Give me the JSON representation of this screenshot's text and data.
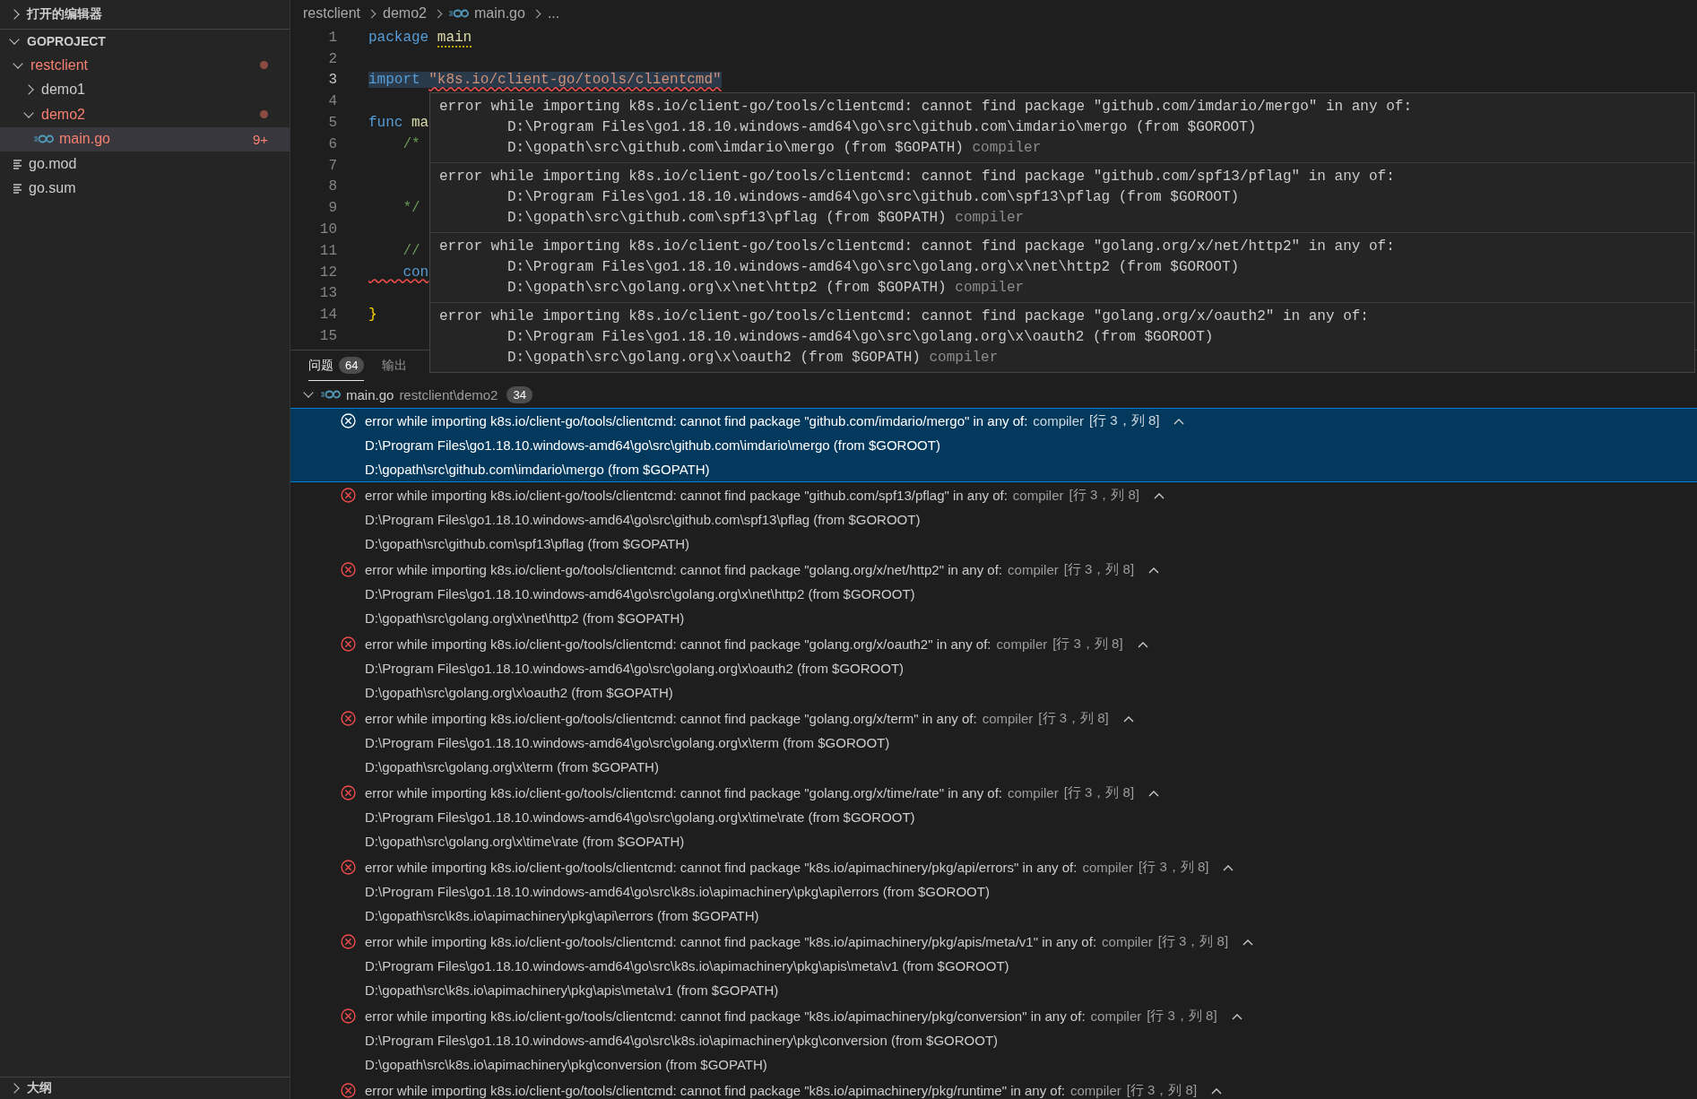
{
  "sidebar": {
    "open_editors": {
      "title": "打开的编辑器",
      "expanded": false
    },
    "explorer": {
      "title": "GOPROJECT",
      "expanded": true,
      "tree": [
        {
          "name": "restclient",
          "kind": "folder",
          "expanded": true,
          "error": true,
          "selected": false,
          "children": [
            {
              "name": "demo1",
              "kind": "folder",
              "expanded": false,
              "error": false,
              "selected": false
            },
            {
              "name": "demo2",
              "kind": "folder",
              "expanded": true,
              "error": true,
              "selected": false,
              "children": [
                {
                  "name": "main.go",
                  "kind": "go",
                  "error": true,
                  "badge": "9+",
                  "selected": true
                }
              ]
            }
          ]
        },
        {
          "name": "go.mod",
          "kind": "text",
          "error": false,
          "selected": false
        },
        {
          "name": "go.sum",
          "kind": "text",
          "error": false,
          "selected": false
        }
      ]
    },
    "outline": {
      "title": "大纲",
      "expanded": false
    }
  },
  "breadcrumb": [
    {
      "label": "restclient",
      "kind": "folder"
    },
    {
      "label": "demo2",
      "kind": "folder"
    },
    {
      "label": "main.go",
      "kind": "go"
    },
    {
      "label": "...",
      "kind": "symbol"
    }
  ],
  "editor": {
    "lines": [
      {
        "number": "1",
        "current": false,
        "segments": [
          {
            "text": "package ",
            "kind": "keyword",
            "error_squiggle": false,
            "warning_squiggle": false
          },
          {
            "text": "main",
            "kind": "ident",
            "error_squiggle": false,
            "warning_squiggle": true
          }
        ]
      },
      {
        "number": "2",
        "current": false
      },
      {
        "number": "3",
        "current": true,
        "highlight": true,
        "segments": [
          {
            "text": "import ",
            "kind": "keyword",
            "error_squiggle": false,
            "warning_squiggle": false
          },
          {
            "text": "\"k8s.io/client-go/tools/clientcmd\"",
            "kind": "string",
            "error_squiggle": true,
            "warning_squiggle": false
          }
        ]
      },
      {
        "number": "4",
        "current": false
      },
      {
        "number": "5",
        "current": false,
        "segments": [
          {
            "text": "func ",
            "kind": "keyword",
            "error_squiggle": false,
            "warning_squiggle": false
          },
          {
            "text": "ma",
            "kind": "ident",
            "error_squiggle": false,
            "warning_squiggle": false
          }
        ]
      },
      {
        "number": "6",
        "current": false,
        "segments": [
          {
            "text": "    /*",
            "kind": "comment",
            "error_squiggle": false,
            "warning_squiggle": false
          }
        ]
      },
      {
        "number": "7",
        "current": false
      },
      {
        "number": "8",
        "current": false
      },
      {
        "number": "9",
        "current": false,
        "segments": [
          {
            "text": "    */",
            "kind": "comment",
            "error_squiggle": false,
            "warning_squiggle": false
          }
        ]
      },
      {
        "number": "10",
        "current": false
      },
      {
        "number": "11",
        "current": false,
        "segments": [
          {
            "text": "    //",
            "kind": "comment",
            "error_squiggle": false,
            "warning_squiggle": false
          }
        ]
      },
      {
        "number": "12",
        "current": false,
        "segments": [
          {
            "text": "    con",
            "kind": "keyword",
            "error_squiggle": true,
            "warning_squiggle": false
          }
        ]
      },
      {
        "number": "13",
        "current": false
      },
      {
        "number": "14",
        "current": false,
        "segments": [
          {
            "text": "}",
            "kind": "brace",
            "error_squiggle": false,
            "warning_squiggle": false
          }
        ]
      },
      {
        "number": "15",
        "current": false
      }
    ]
  },
  "hover": {
    "items": [
      {
        "message": "error while importing k8s.io/client-go/tools/clientcmd: cannot find package \"github.com/imdario/mergo\" in any of:",
        "goroot": "D:\\Program Files\\go1.18.10.windows-amd64\\go\\src\\github.com\\imdario\\mergo (from $GOROOT)",
        "gopath": "D:\\gopath\\src\\github.com\\imdario\\mergo (from $GOPATH)",
        "source": "compiler"
      },
      {
        "message": "error while importing k8s.io/client-go/tools/clientcmd: cannot find package \"github.com/spf13/pflag\" in any of:",
        "goroot": "D:\\Program Files\\go1.18.10.windows-amd64\\go\\src\\github.com\\spf13\\pflag (from $GOROOT)",
        "gopath": "D:\\gopath\\src\\github.com\\spf13\\pflag (from $GOPATH)",
        "source": "compiler"
      },
      {
        "message": "error while importing k8s.io/client-go/tools/clientcmd: cannot find package \"golang.org/x/net/http2\" in any of:",
        "goroot": "D:\\Program Files\\go1.18.10.windows-amd64\\go\\src\\golang.org\\x\\net\\http2 (from $GOROOT)",
        "gopath": "D:\\gopath\\src\\golang.org\\x\\net\\http2 (from $GOPATH)",
        "source": "compiler"
      },
      {
        "message": "error while importing k8s.io/client-go/tools/clientcmd: cannot find package \"golang.org/x/oauth2\" in any of:",
        "goroot": "D:\\Program Files\\go1.18.10.windows-amd64\\go\\src\\golang.org\\x\\oauth2 (from $GOROOT)",
        "gopath": "D:\\gopath\\src\\golang.org\\x\\oauth2 (from $GOPATH)",
        "source": "compiler"
      }
    ]
  },
  "panel": {
    "tabs": [
      {
        "label": "问题",
        "badge": "64",
        "selected": true
      },
      {
        "label": "输出",
        "selected": false
      }
    ],
    "group": {
      "file": "main.go",
      "path": "restclient\\demo2",
      "count": "34",
      "expanded": true
    },
    "problems": [
      {
        "message": "error while importing k8s.io/client-go/tools/clientcmd: cannot find package \"github.com/imdario/mergo\" in any of:",
        "source": "compiler",
        "location": "[行 3，列 8]",
        "selected": true,
        "lines": [
          "D:\\Program Files\\go1.18.10.windows-amd64\\go\\src\\github.com\\imdario\\mergo (from $GOROOT)",
          "D:\\gopath\\src\\github.com\\imdario\\mergo (from $GOPATH)"
        ]
      },
      {
        "message": "error while importing k8s.io/client-go/tools/clientcmd: cannot find package \"github.com/spf13/pflag\" in any of:",
        "source": "compiler",
        "location": "[行 3，列 8]",
        "selected": false,
        "lines": [
          "D:\\Program Files\\go1.18.10.windows-amd64\\go\\src\\github.com\\spf13\\pflag (from $GOROOT)",
          "D:\\gopath\\src\\github.com\\spf13\\pflag (from $GOPATH)"
        ]
      },
      {
        "message": "error while importing k8s.io/client-go/tools/clientcmd: cannot find package \"golang.org/x/net/http2\" in any of:",
        "source": "compiler",
        "location": "[行 3，列 8]",
        "selected": false,
        "lines": [
          "D:\\Program Files\\go1.18.10.windows-amd64\\go\\src\\golang.org\\x\\net\\http2 (from $GOROOT)",
          "D:\\gopath\\src\\golang.org\\x\\net\\http2 (from $GOPATH)"
        ]
      },
      {
        "message": "error while importing k8s.io/client-go/tools/clientcmd: cannot find package \"golang.org/x/oauth2\" in any of:",
        "source": "compiler",
        "location": "[行 3，列 8]",
        "selected": false,
        "lines": [
          "D:\\Program Files\\go1.18.10.windows-amd64\\go\\src\\golang.org\\x\\oauth2 (from $GOROOT)",
          "D:\\gopath\\src\\golang.org\\x\\oauth2 (from $GOPATH)"
        ]
      },
      {
        "message": "error while importing k8s.io/client-go/tools/clientcmd: cannot find package \"golang.org/x/term\" in any of:",
        "source": "compiler",
        "location": "[行 3，列 8]",
        "selected": false,
        "lines": [
          "D:\\Program Files\\go1.18.10.windows-amd64\\go\\src\\golang.org\\x\\term (from $GOROOT)",
          "D:\\gopath\\src\\golang.org\\x\\term (from $GOPATH)"
        ]
      },
      {
        "message": "error while importing k8s.io/client-go/tools/clientcmd: cannot find package \"golang.org/x/time/rate\" in any of:",
        "source": "compiler",
        "location": "[行 3，列 8]",
        "selected": false,
        "lines": [
          "D:\\Program Files\\go1.18.10.windows-amd64\\go\\src\\golang.org\\x\\time\\rate (from $GOROOT)",
          "D:\\gopath\\src\\golang.org\\x\\time\\rate (from $GOPATH)"
        ]
      },
      {
        "message": "error while importing k8s.io/client-go/tools/clientcmd: cannot find package \"k8s.io/apimachinery/pkg/api/errors\" in any of:",
        "source": "compiler",
        "location": "[行 3，列 8]",
        "selected": false,
        "lines": [
          "D:\\Program Files\\go1.18.10.windows-amd64\\go\\src\\k8s.io\\apimachinery\\pkg\\api\\errors (from $GOROOT)",
          "D:\\gopath\\src\\k8s.io\\apimachinery\\pkg\\api\\errors (from $GOPATH)"
        ]
      },
      {
        "message": "error while importing k8s.io/client-go/tools/clientcmd: cannot find package \"k8s.io/apimachinery/pkg/apis/meta/v1\" in any of:",
        "source": "compiler",
        "location": "[行 3，列 8]",
        "selected": false,
        "lines": [
          "D:\\Program Files\\go1.18.10.windows-amd64\\go\\src\\k8s.io\\apimachinery\\pkg\\apis\\meta\\v1 (from $GOROOT)",
          "D:\\gopath\\src\\k8s.io\\apimachinery\\pkg\\apis\\meta\\v1 (from $GOPATH)"
        ]
      },
      {
        "message": "error while importing k8s.io/client-go/tools/clientcmd: cannot find package \"k8s.io/apimachinery/pkg/conversion\" in any of:",
        "source": "compiler",
        "location": "[行 3，列 8]",
        "selected": false,
        "lines": [
          "D:\\Program Files\\go1.18.10.windows-amd64\\go\\src\\k8s.io\\apimachinery\\pkg\\conversion (from $GOROOT)",
          "D:\\gopath\\src\\k8s.io\\apimachinery\\pkg\\conversion (from $GOPATH)"
        ]
      },
      {
        "message": "error while importing k8s.io/client-go/tools/clientcmd: cannot find package \"k8s.io/apimachinery/pkg/runtime\" in any of:",
        "source": "compiler",
        "location": "[行 3，列 8]",
        "selected": false
      }
    ]
  }
}
